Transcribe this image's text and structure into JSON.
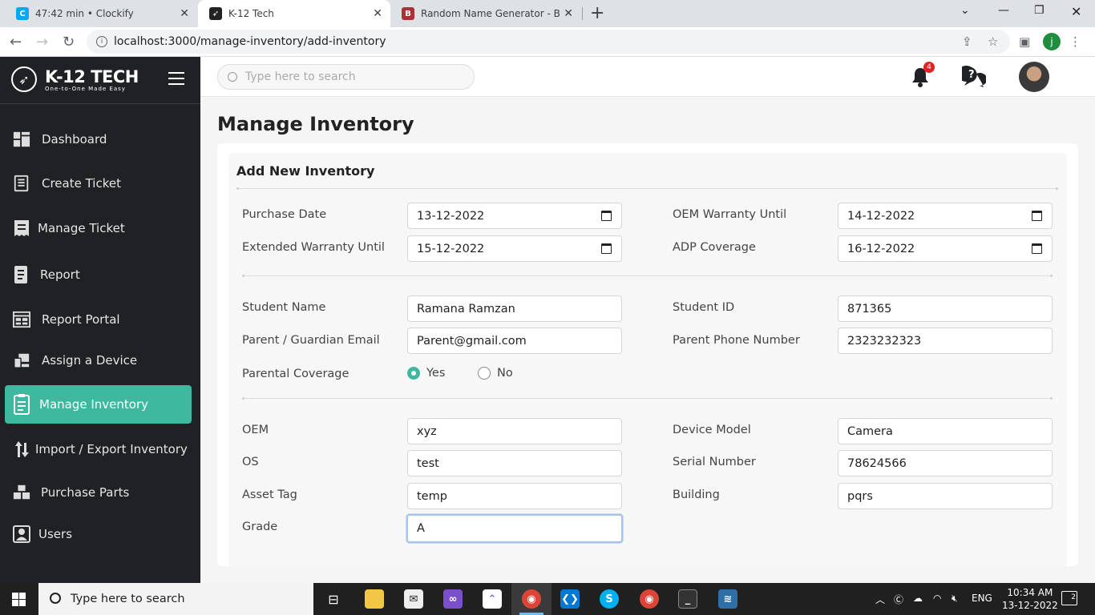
{
  "browser": {
    "tabs": [
      {
        "title": "47:42 min • Clockify",
        "icon": "clockify-icon"
      },
      {
        "title": "K-12 Tech",
        "icon": "k12-rocket-icon"
      },
      {
        "title": "Random Name Generator - Behin",
        "icon": "behind-the-name-icon"
      }
    ],
    "url": "localhost:3000/manage-inventory/add-inventory",
    "profile_initial": "j"
  },
  "brand": {
    "name": "K-12 TECH",
    "tagline": "One-to-One Made Easy"
  },
  "sidebar": {
    "items": [
      {
        "label": "Dashboard",
        "icon": "dashboard-icon"
      },
      {
        "label": "Create Ticket",
        "icon": "create-ticket-icon"
      },
      {
        "label": "Manage Ticket",
        "icon": "manage-ticket-icon"
      },
      {
        "label": "Report",
        "icon": "report-icon"
      },
      {
        "label": "Report Portal",
        "icon": "report-portal-icon"
      },
      {
        "label": "Assign a Device",
        "icon": "assign-device-icon"
      },
      {
        "label": "Manage Inventory",
        "icon": "manage-inventory-icon",
        "active": true
      },
      {
        "label": "Import / Export Inventory",
        "icon": "import-export-icon"
      },
      {
        "label": "Purchase Parts",
        "icon": "purchase-parts-icon"
      },
      {
        "label": "Users",
        "icon": "users-icon"
      }
    ]
  },
  "header": {
    "search_placeholder": "Type here to search",
    "notification_count": "4"
  },
  "page": {
    "title": "Manage Inventory",
    "card_title": "Add New Inventory"
  },
  "form": {
    "purchase_date": {
      "label": "Purchase Date",
      "value": "13-12-2022"
    },
    "oem_warranty": {
      "label": "OEM Warranty Until",
      "value": "14-12-2022"
    },
    "extended_warranty": {
      "label": "Extended Warranty Until",
      "value": "15-12-2022"
    },
    "adp_coverage": {
      "label": "ADP Coverage",
      "value": "16-12-2022"
    },
    "student_name": {
      "label": "Student Name",
      "value": "Ramana Ramzan"
    },
    "student_id": {
      "label": "Student ID",
      "value": "871365"
    },
    "parent_email": {
      "label": "Parent / Guardian Email",
      "value": "Parent@gmail.com"
    },
    "parent_phone": {
      "label": "Parent Phone Number",
      "value": "2323232323"
    },
    "parental_coverage": {
      "label": "Parental Coverage",
      "yes": "Yes",
      "no": "No",
      "selected": "Yes"
    },
    "oem": {
      "label": "OEM",
      "value": "xyz"
    },
    "device_model": {
      "label": "Device Model",
      "value": "Camera"
    },
    "os": {
      "label": "OS",
      "value": "test"
    },
    "serial_number": {
      "label": "Serial Number",
      "value": "78624566"
    },
    "asset_tag": {
      "label": "Asset Tag",
      "value": "temp"
    },
    "building": {
      "label": "Building",
      "value": "pqrs"
    },
    "grade": {
      "label": "Grade",
      "value": "A"
    }
  },
  "taskbar": {
    "search_placeholder": "Type here to search",
    "language": "ENG",
    "time": "10:34 AM",
    "date": "13-12-2022",
    "notifications": "2"
  },
  "colors": {
    "accent": "#3fb8a0",
    "sidebar_bg": "#1f2125",
    "badge": "#e02424"
  }
}
